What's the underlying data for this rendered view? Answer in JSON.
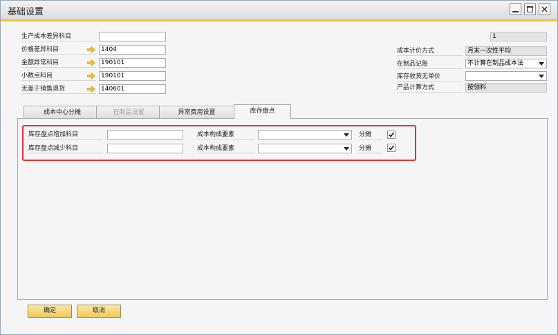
{
  "window": {
    "title": "基础设置"
  },
  "left_form": {
    "rows": [
      {
        "label": "生产成本差异科目",
        "value": "",
        "has_arrow": false
      },
      {
        "label": "价格差异科目",
        "value": "1404",
        "has_arrow": true
      },
      {
        "label": "金额异常科目",
        "value": "190101",
        "has_arrow": true
      },
      {
        "label": "小数点科目",
        "value": "190101",
        "has_arrow": true
      },
      {
        "label": "无差于销售退货",
        "value": "140601",
        "has_arrow": true
      }
    ]
  },
  "right_form": {
    "top_value": "1",
    "rows": [
      {
        "label": "成本计价方式",
        "value": "月末一次性平均",
        "kind": "readonly"
      },
      {
        "label": "在制品记账",
        "value": "不计算在制品成本法",
        "kind": "dropdown"
      },
      {
        "label": "库存收货无单价",
        "value": "",
        "kind": "dropdown"
      },
      {
        "label": "产品计算方式",
        "value": "按领料",
        "kind": "readonly"
      }
    ]
  },
  "tabs": [
    {
      "label": "成本中心分摊",
      "state": "normal"
    },
    {
      "label": "在制品设置",
      "state": "disabled"
    },
    {
      "label": "异常费用设置",
      "state": "normal"
    },
    {
      "label": "库存盘点",
      "state": "active"
    }
  ],
  "inventory_tab": {
    "rows": [
      {
        "label": "库存盘点增加科目",
        "value": "",
        "element_label": "成本构成要素",
        "element_value": "",
        "allocation_label": "分摊",
        "allocation_checked": true
      },
      {
        "label": "库存盘点减少科目",
        "value": "",
        "element_label": "成本构成要素",
        "element_value": "",
        "allocation_label": "分摊",
        "allocation_checked": true
      }
    ]
  },
  "buttons": {
    "ok_label": "确定",
    "cancel_label": "取消"
  },
  "colors": {
    "accent": "#f2c23a",
    "highlight_border": "#e53030",
    "button_fill": "#f0c95b"
  }
}
